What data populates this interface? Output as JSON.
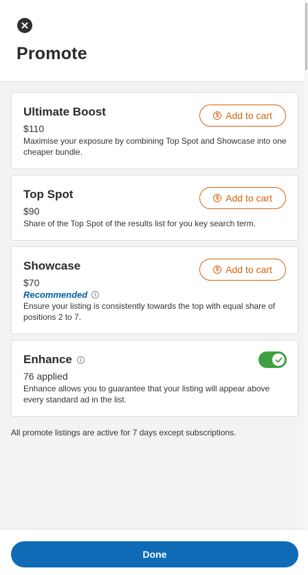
{
  "header": {
    "title": "Promote",
    "close_icon": "close-icon"
  },
  "cards": [
    {
      "title": "Ultimate Boost",
      "price": "$110",
      "description": "Maximise your exposure by combining Top Spot and Showcase into one cheaper bundle.",
      "button_label": "Add to cart"
    },
    {
      "title": "Top Spot",
      "price": "$90",
      "description": "Share of the Top Spot of the results list for you key search term.",
      "button_label": "Add to cart"
    },
    {
      "title": "Showcase",
      "price": "$70",
      "badge": "Recommended",
      "description": "Ensure your listing is consistently towards the top with equal share of positions 2 to 7.",
      "button_label": "Add to cart"
    },
    {
      "title": "Enhance",
      "applied": "76 applied",
      "description": "Enhance allows you to guarantee that your listing will appear above every standard ad in the list.",
      "toggle_on": true
    }
  ],
  "footnote": "All promote listings are active for 7 days except subscriptions.",
  "footer": {
    "done_label": "Done"
  },
  "colors": {
    "accent_orange": "#d7620c",
    "brand_blue": "#0f6bb6",
    "recommended_blue": "#00609c",
    "toggle_green": "#3fa040"
  }
}
